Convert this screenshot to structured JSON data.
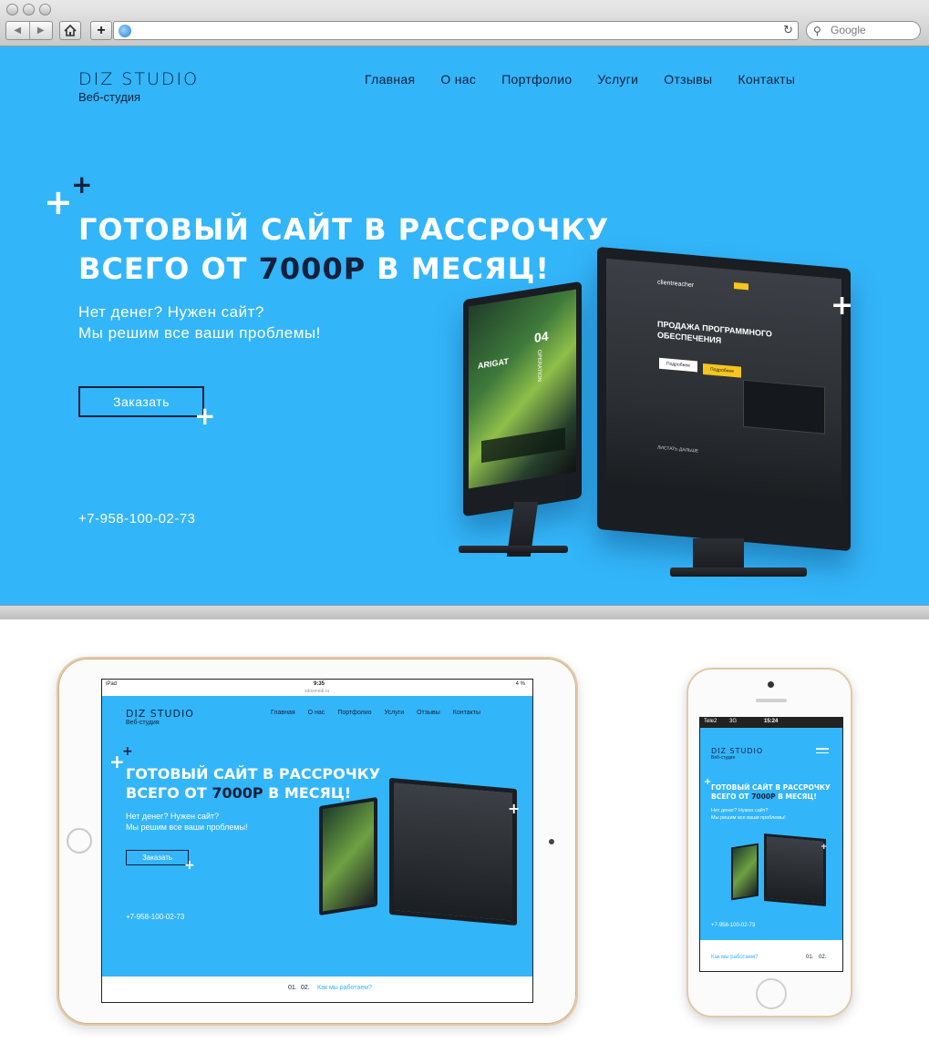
{
  "browser": {
    "search_placeholder": "Google",
    "icons": [
      "back-icon",
      "forward-icon",
      "home-icon",
      "new-tab-icon",
      "globe-icon",
      "reload-icon",
      "search-icon"
    ]
  },
  "site": {
    "logo": "DIZ STUDIO",
    "logo_sub": "Веб-студия",
    "menu": [
      "Главная",
      "О нас",
      "Портфолио",
      "Услуги",
      "Отзывы",
      "Контакты"
    ],
    "headline_1": "ГОТОВЫЙ САЙТ В РАССРОЧКУ",
    "headline_2a": "ВСЕГО ОТ ",
    "headline_2b": "7000Р",
    "headline_2c": " В МЕСЯЦ!",
    "sub_1": "Нет денег? Нужен сайт?",
    "sub_2": "Мы решим все ваши проблемы!",
    "order_button": "Заказать",
    "phone": "+7-958-100-02-73",
    "how_we_work": "Как мы работаем?",
    "steps": [
      "01.",
      "02."
    ]
  },
  "mockup_screen": {
    "left_brand": "ARIGAT",
    "left_badge": "04",
    "left_vertical": "OPERATION",
    "right_brand": "clientreacher",
    "right_title_1": "ПРОДАЖА ПРОГРАММНОГО",
    "right_title_2": "ОБЕСПЕЧЕНИЯ",
    "right_btn_1": "Подробнее",
    "right_btn_2": "Подробнее",
    "right_footer": "ЛИСТАТЬ ДАЛЬШЕ"
  },
  "ipad": {
    "status_left": "iPad",
    "status_time": "9:35",
    "status_right": "4 %",
    "url": "sdosmedi.ru"
  },
  "iphone": {
    "carrier": "Tele2",
    "network": "3G",
    "time": "15:24"
  },
  "colors": {
    "site_bg": "#33b5fa",
    "dark": "#14203a",
    "accent_yellow": "#f7c51e"
  }
}
